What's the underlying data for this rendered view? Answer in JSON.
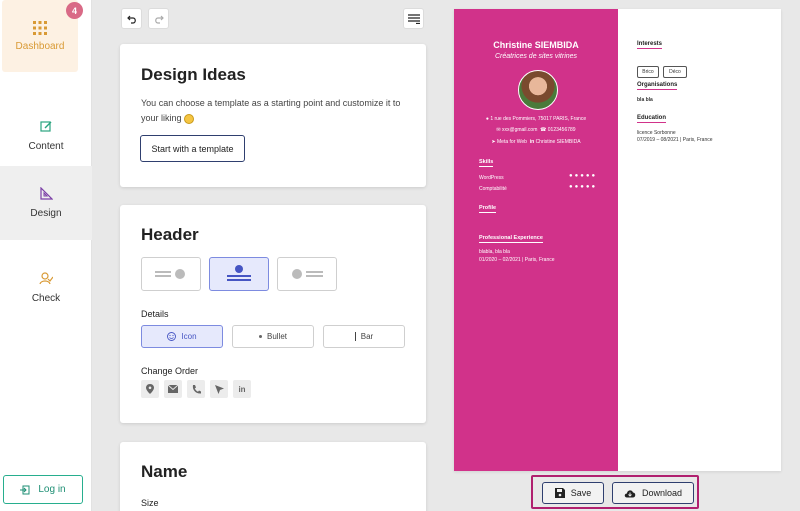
{
  "sidebar": {
    "badge_count": "4",
    "items": [
      {
        "label": "Dashboard",
        "icon": "grid-icon"
      },
      {
        "label": "Content",
        "icon": "edit-icon"
      },
      {
        "label": "Design",
        "icon": "design-icon"
      },
      {
        "label": "Check",
        "icon": "check-icon"
      }
    ],
    "login_label": "Log in"
  },
  "toolbar": {
    "undo_icon": "undo-icon",
    "redo_icon": "redo-icon",
    "menu_icon": "menu-icon"
  },
  "design_ideas": {
    "title": "Design Ideas",
    "description": "You can choose a template as a starting point and customize it to your liking",
    "button_label": "Start with a template"
  },
  "header_section": {
    "title": "Header",
    "details_label": "Details",
    "styles": [
      "Icon",
      "Bullet",
      "Bar"
    ],
    "change_order_label": "Change Order"
  },
  "name_section": {
    "title": "Name",
    "size_label": "Size"
  },
  "cv": {
    "name": "Christine SIEMBIDA",
    "job": "Créatrices de sites vitrines",
    "address": "1 rue des Pommiers, 75017 PARIS, France",
    "email": "xxx@gmail.com",
    "phone": "0123456789",
    "website": "Meta for Web",
    "linkedin": "Christine SIEMBIDA",
    "skills_title": "Skills",
    "skills": [
      "WordPress",
      "Comptabilité"
    ],
    "profile_title": "Profile",
    "experience_title": "Professional Experience",
    "experience_line1": "blabla, bla bla",
    "experience_line2": "01/2020 – 02/2021 | Paris, France",
    "interests_title": "Interests",
    "interests": [
      "Brico",
      "Déco"
    ],
    "organisations_title": "Organisations",
    "organisations_text": "bla bla",
    "education_title": "Education",
    "education_line1": "licence Sorbonne",
    "education_line2": "07/2019 – 08/2021 | Paris, France"
  },
  "actions": {
    "save_label": "Save",
    "download_label": "Download"
  },
  "colors": {
    "accent": "#d1328a",
    "primary": "#2f3f6f",
    "selected_bg": "#e6e9fc"
  }
}
